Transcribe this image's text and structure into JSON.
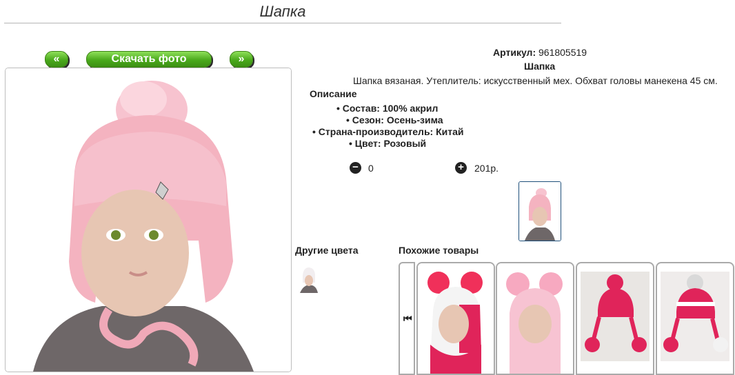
{
  "header": {
    "title": "Шапка"
  },
  "gallery": {
    "prev_label": "«",
    "download_label": "Скачать фото",
    "next_label": "»"
  },
  "product": {
    "article_label": "Артикул:",
    "article_value": "961805519",
    "name": "Шапка",
    "description": "Шапка вязаная. Утеплитель: искусственный мех. Обхват головы манекена 45 см.",
    "description_heading": "Описание",
    "specs": [
      "Состав: 100% акрил",
      "Сезон: Осень-зима",
      "Страна-производитель: Китай",
      "Цвет: Розовый"
    ]
  },
  "cart": {
    "quantity": "0",
    "price": "201р."
  },
  "sections": {
    "other_colors": "Другие цвета",
    "similar": "Похожие товары"
  },
  "colors": {
    "accent_green": "#4aa91c",
    "hat_pink": "#f4b3c0",
    "thumb_border": "#1e4f7a"
  }
}
